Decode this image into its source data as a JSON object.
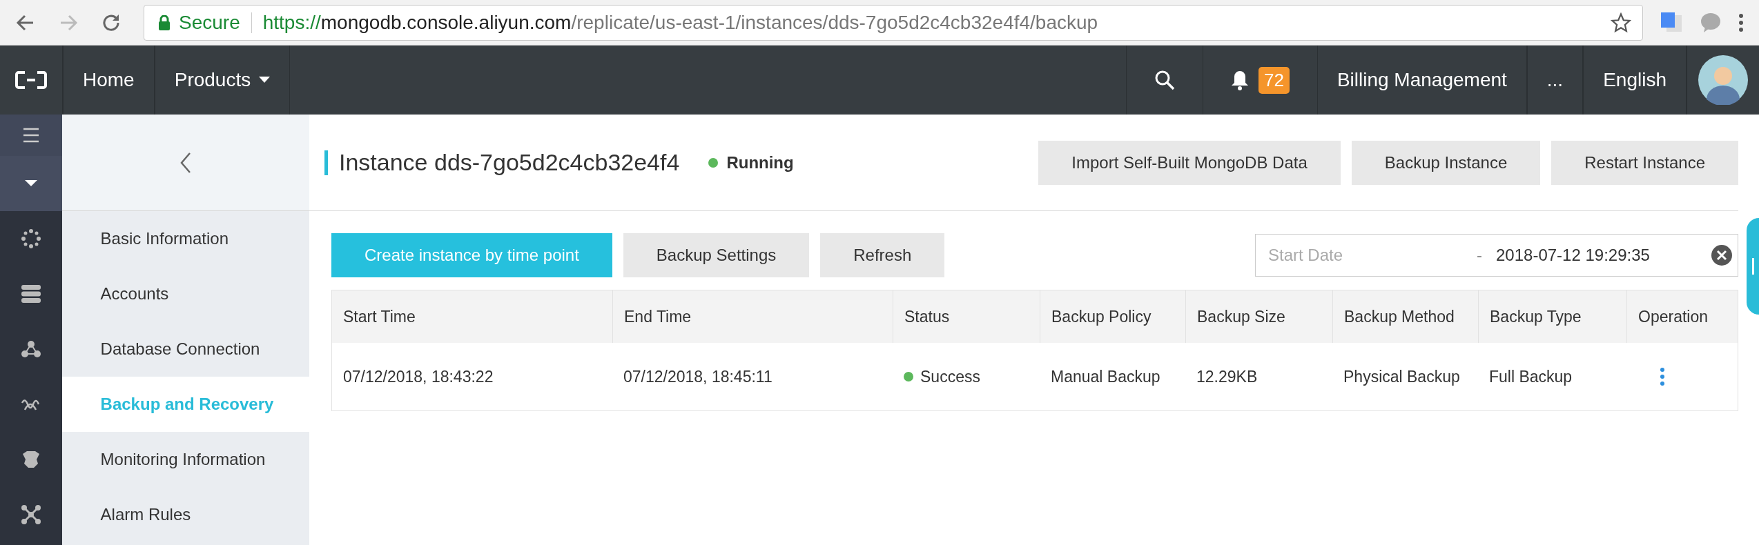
{
  "browser": {
    "secure_label": "Secure",
    "url_scheme": "https://",
    "url_host": "mongodb.console.aliyun.com",
    "url_path": "/replicate/us-east-1/instances/dds-7go5d2c4cb32e4f4/backup"
  },
  "top_nav": {
    "items": [
      {
        "label": "Home",
        "kind": "link"
      },
      {
        "label": "Products",
        "kind": "dropdown"
      }
    ],
    "notification_count": "72",
    "billing": "Billing Management",
    "more": "...",
    "language": "English"
  },
  "sidebar": {
    "items": [
      {
        "label": "Basic Information",
        "selected": false
      },
      {
        "label": "Accounts",
        "selected": false
      },
      {
        "label": "Database Connection",
        "selected": false
      },
      {
        "label": "Backup and Recovery",
        "selected": true
      },
      {
        "label": "Monitoring Information",
        "selected": false
      },
      {
        "label": "Alarm Rules",
        "selected": false
      }
    ]
  },
  "header": {
    "title": "Instance dds-7go5d2c4cb32e4f4",
    "status": "Running",
    "buttons": [
      "Import Self-Built MongoDB Data",
      "Backup Instance",
      "Restart Instance"
    ]
  },
  "toolbar": {
    "buttons": [
      {
        "label": "Create instance by time point",
        "primary": true
      },
      {
        "label": "Backup Settings",
        "primary": false
      },
      {
        "label": "Refresh",
        "primary": false
      }
    ],
    "date_range": {
      "start_placeholder": "Start Date",
      "separator": "-",
      "end_value": "2018-07-12 19:29:35"
    }
  },
  "table": {
    "columns": [
      "Start Time",
      "End Time",
      "Status",
      "Backup Policy",
      "Backup Size",
      "Backup Method",
      "Backup Type",
      "Operation"
    ],
    "rows": [
      {
        "start_time": "07/12/2018, 18:43:22",
        "end_time": "07/12/2018, 18:45:11",
        "status": "Success",
        "color": "#5cb85c",
        "policy": "Manual Backup",
        "size": "12.29KB",
        "method": "Physical Backup",
        "type": "Full Backup"
      }
    ]
  }
}
